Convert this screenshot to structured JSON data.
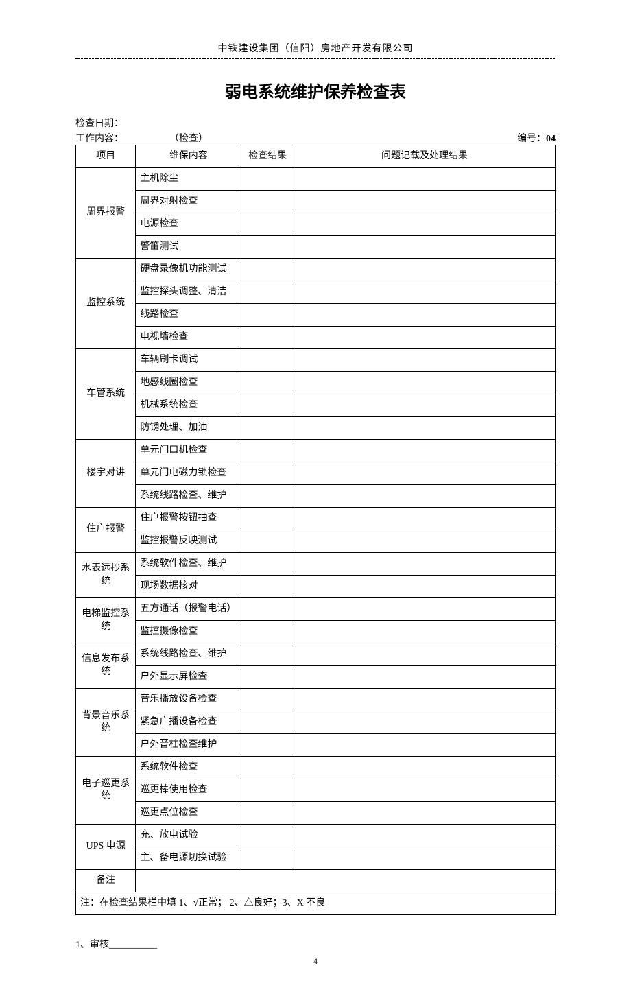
{
  "company": "中铁建设集团（信阳）房地产开发有限公司",
  "title": "弱电系统维护保养检查表",
  "date_label": "检查日期：",
  "work_content_label": "工作内容：",
  "work_content_value": "（检查）",
  "serial_label": "编号：",
  "serial_value": "04",
  "columns": {
    "c1": "项目",
    "c2": "维保内容",
    "c3": "检查结果",
    "c4": "问题记载及处理结果"
  },
  "sections": [
    {
      "project": "周界报警",
      "items": [
        "主机除尘",
        "周界对射检查",
        "电源检查",
        "警笛测试"
      ]
    },
    {
      "project": "监控系统",
      "items": [
        "硬盘录像机功能测试",
        "监控探头调整、清洁",
        "线路检查",
        "电视墙检查"
      ]
    },
    {
      "project": "车管系统",
      "items": [
        "车辆刷卡调试",
        "地感线圈检查",
        "机械系统检查",
        "防锈处理、加油"
      ]
    },
    {
      "project": "楼宇对讲",
      "items": [
        "单元门口机检查",
        "单元门电磁力锁检查",
        "系统线路检查、维护"
      ]
    },
    {
      "project": "住户报警",
      "items": [
        "住户报警按钮抽查",
        "监控报警反映测试"
      ]
    },
    {
      "project": "水表远抄系统",
      "items": [
        "系统软件检查、维护",
        "现场数据核对"
      ]
    },
    {
      "project": "电梯监控系统",
      "items": [
        "五方通话（报警电话）",
        "监控摄像检查"
      ]
    },
    {
      "project": "信息发布系统",
      "items": [
        "系统线路检查、维护",
        "户外显示屏检查"
      ]
    },
    {
      "project": "背景音乐系统",
      "items": [
        "音乐播放设备检查",
        "紧急广播设备检查",
        "户外音柱检查维护"
      ]
    },
    {
      "project": "电子巡更系统",
      "items": [
        "系统软件检查",
        "巡更棒使用检查",
        "巡更点位检查"
      ]
    },
    {
      "project": "UPS 电源",
      "items": [
        "充、放电试验",
        "主、备电源切换试验"
      ]
    }
  ],
  "remark_label": "备注",
  "note": "注：在检查结果栏中填 1、√正常； 2、△良好；3、X 不良",
  "footer_sign": "1、审核__________",
  "page_number": "4"
}
